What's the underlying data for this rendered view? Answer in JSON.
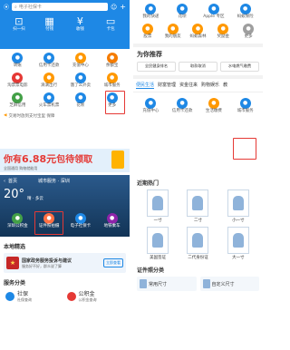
{
  "top_left": {
    "search_placeholder": "电子社保卡",
    "quick": [
      {
        "label": "扫一扫",
        "icon": "scan-icon"
      },
      {
        "label": "付钱",
        "icon": "pay-icon"
      },
      {
        "label": "收钱",
        "icon": "receive-icon"
      },
      {
        "label": "卡包",
        "icon": "card-icon"
      }
    ],
    "apps": [
      {
        "label": "转账",
        "color": "#1e88e5"
      },
      {
        "label": "信用卡还款",
        "color": "#1e88e5"
      },
      {
        "label": "充值中心",
        "color": "#ff9800"
      },
      {
        "label": "余额宝",
        "color": "#f57c00"
      },
      {
        "label": "淘票票电影",
        "color": "#e53935"
      },
      {
        "label": "滴滴出行",
        "color": "#ff9800"
      },
      {
        "label": "饿了么外卖",
        "color": "#1e88e5"
      },
      {
        "label": "城市服务",
        "color": "#ff9800"
      },
      {
        "label": "芝麻信用",
        "color": "#43a047"
      },
      {
        "label": "火车票机票",
        "color": "#1e88e5"
      },
      {
        "label": "花呗",
        "color": "#1e88e5"
      },
      {
        "label": "更多",
        "color": "#1e88e5"
      }
    ],
    "notice": "交易时放到支付宝里 保障",
    "promo_title": "你有6.88元包待领取",
    "promo_prefix": "你有",
    "promo_amount": "6.88元",
    "promo_suffix": "包待领取",
    "promo_sub": "全国通用 购物就能用"
  },
  "top_right": {
    "row1": [
      "我的快递",
      "花呗",
      "Apple 专区",
      "蚂蚁保险"
    ],
    "row2": [
      "股票",
      "我的朋友",
      "蚂蚁森林",
      "奖励金",
      "更多"
    ],
    "recommend_title": "为你推荐",
    "recommend": [
      "全民健身排名",
      "取款取消",
      "水电燃气缴费",
      "跨境汇款"
    ],
    "tabs": [
      "便民生活",
      "财富管理",
      "资金往来",
      "购物娱乐",
      "教"
    ],
    "services": [
      {
        "label": "充值中心",
        "color": "#1e88e5"
      },
      {
        "label": "信用卡还款",
        "color": "#1e88e5"
      },
      {
        "label": "生活缴费",
        "color": "#ff9800"
      },
      {
        "label": "城市服务",
        "color": "#1e88e5"
      }
    ]
  },
  "bottom_left": {
    "back_label": "首页",
    "title": "城市服务 · 深圳",
    "temp": "20°",
    "weather": "晴 · 多云",
    "features": [
      {
        "label": "深圳公积金",
        "color": "#43a047"
      },
      {
        "label": "证件照拍摄",
        "color": "#ff7043"
      },
      {
        "label": "电子社保卡",
        "color": "#1e88e5"
      },
      {
        "label": "地铁乘车",
        "color": "#8e24aa"
      }
    ],
    "section_title": "本地精选",
    "banner_title": "国家政务服务投诉与建议",
    "banner_sub": "服务好不好，群众说了算",
    "banner_btn": "立即查看",
    "section2_title": "服务分类",
    "cats": [
      {
        "label": "社保",
        "sub": "社保查询",
        "color": "#1e88e5"
      },
      {
        "label": "公积金",
        "sub": "公积金查询",
        "color": "#e53935"
      }
    ]
  },
  "bottom_right": {
    "title": "近期热门",
    "photos": [
      {
        "label": "一寸"
      },
      {
        "label": "二寸"
      },
      {
        "label": "小一寸"
      },
      {
        "label": "美国签证"
      },
      {
        "label": "二代身份证"
      },
      {
        "label": "大一寸"
      }
    ],
    "cert_title": "证件照分类",
    "cert_left": "常用尺寸",
    "cert_right": "自定义尺寸"
  }
}
